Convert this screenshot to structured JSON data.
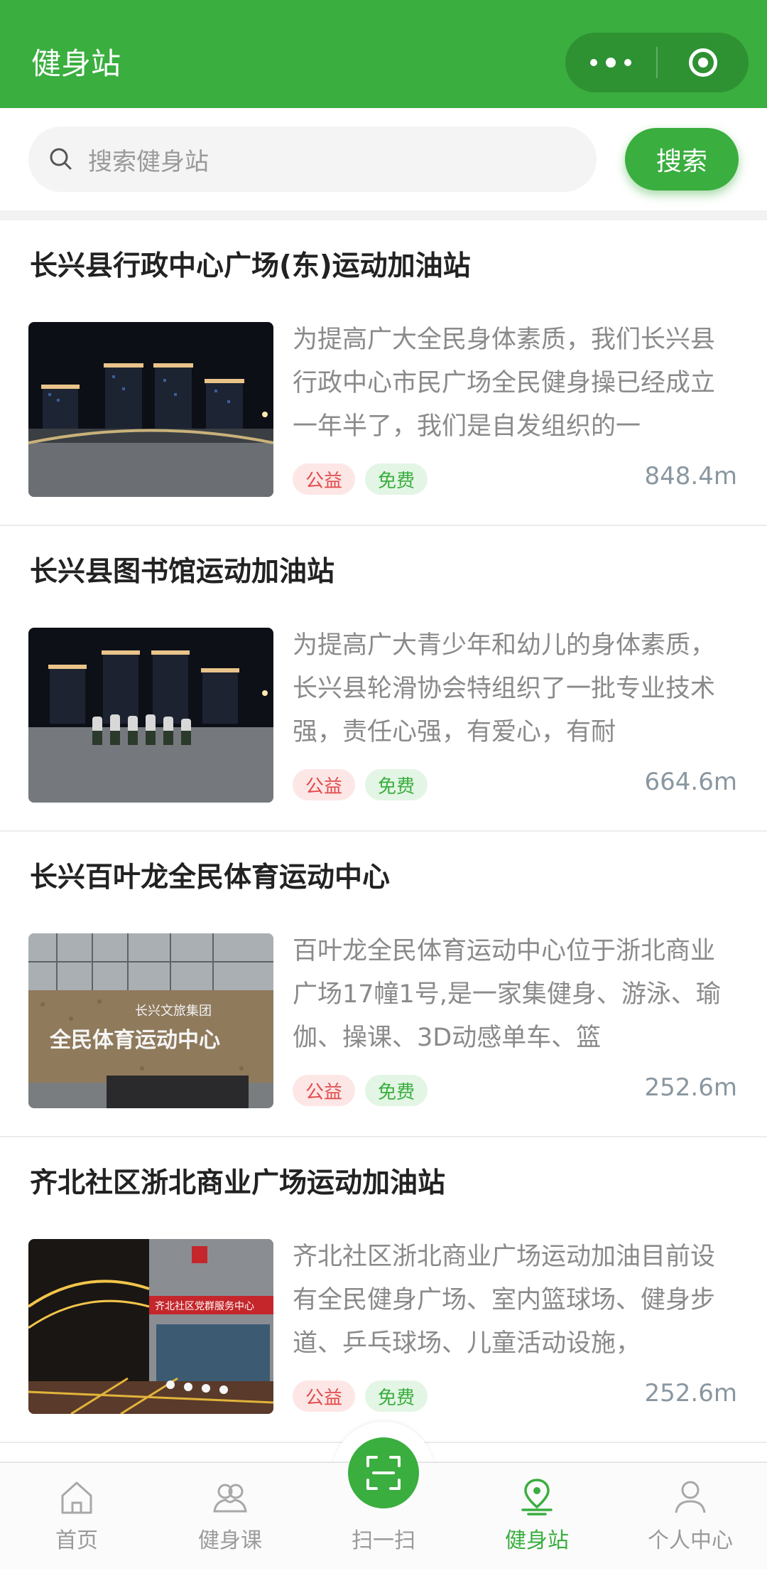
{
  "header": {
    "title": "健身站"
  },
  "search": {
    "placeholder": "搜索健身站",
    "button": "搜索"
  },
  "stations": [
    {
      "title": "长兴县行政中心广场(东)运动加油站",
      "desc": "为提高广大全民身体素质，我们长兴县行政中心市民广场全民健身操已经成立一年半了，我们是自发组织的一",
      "tags": [
        "公益",
        "免费"
      ],
      "distance": "848.4m"
    },
    {
      "title": "长兴县图书馆运动加油站",
      "desc": "为提高广大青少年和幼儿的身体素质，长兴县轮滑协会特组织了一批专业技术强，责任心强，有爱心，有耐",
      "tags": [
        "公益",
        "免费"
      ],
      "distance": "664.6m"
    },
    {
      "title": "长兴百叶龙全民体育运动中心",
      "desc": "百叶龙全民体育运动中心位于浙北商业广场17幢1号,是一家集健身、游泳、瑜伽、操课、3D动感单车、篮",
      "tags": [
        "公益",
        "免费"
      ],
      "distance": "252.6m"
    },
    {
      "title": "齐北社区浙北商业广场运动加油站",
      "desc": "齐北社区浙北商业广场运动加油目前设有全民健身广场、室内篮球场、健身步道、乒乓球场、儿童活动设施，",
      "tags": [
        "公益",
        "免费"
      ],
      "distance": "252.6m"
    }
  ],
  "thumb_text": {
    "sign_small": "长兴文旅集团",
    "sign_big": "全民体育运动中心",
    "service_center": "齐北社区党群服务中心"
  },
  "nav": [
    {
      "label": "首页",
      "icon": "home-icon"
    },
    {
      "label": "健身课",
      "icon": "users-icon"
    },
    {
      "label": "扫一扫",
      "icon": "scan-icon"
    },
    {
      "label": "健身站",
      "icon": "location-pin-icon",
      "active": true
    },
    {
      "label": "个人中心",
      "icon": "person-icon"
    }
  ],
  "colors": {
    "brand": "#3aae3f",
    "tag_red": "#e24b4b",
    "tag_green": "#3aae3f"
  }
}
